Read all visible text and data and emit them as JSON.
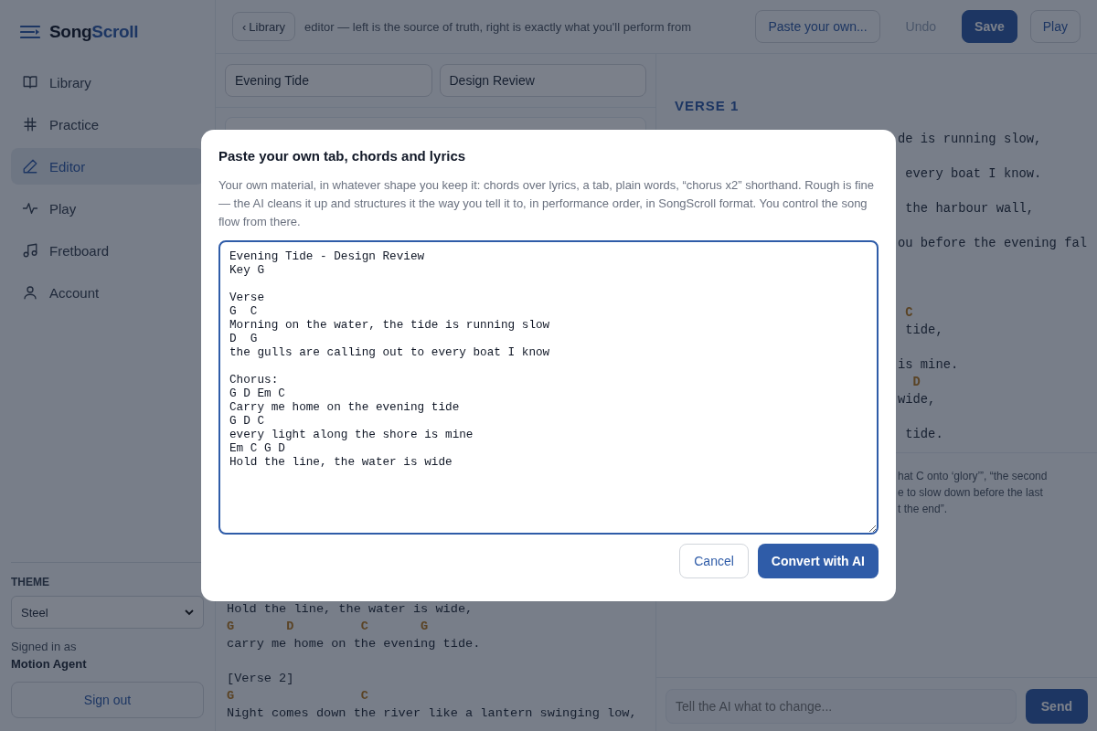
{
  "app": {
    "logo_prefix": "Song",
    "logo_suffix": "Scroll"
  },
  "sidebar": {
    "items": [
      {
        "label": "Library",
        "selected": false
      },
      {
        "label": "Practice",
        "selected": false
      },
      {
        "label": "Editor",
        "selected": true
      },
      {
        "label": "Play",
        "selected": false
      },
      {
        "label": "Fretboard",
        "selected": false
      },
      {
        "label": "Account",
        "selected": false
      }
    ],
    "theme_label": "THEME",
    "theme_value": "Steel",
    "signed_in_label": "Signed in as",
    "user_name": "Motion Agent",
    "sign_out": "Sign out"
  },
  "toolbar": {
    "back_icon": "‹",
    "back_button": "Library",
    "subtitle": "editor — left is the source of truth, right is exactly what you'll perform from",
    "buttons": [
      {
        "label": "Paste your own...",
        "kind": "outline",
        "disabled": false
      },
      {
        "label": "Undo",
        "kind": "plain",
        "disabled": true
      },
      {
        "label": "Save",
        "kind": "primary",
        "disabled": false
      },
      {
        "label": "Play",
        "kind": "outline",
        "disabled": false
      }
    ]
  },
  "editor": {
    "title": "Evening Tide",
    "artist": "Design Review",
    "lines": [
      {
        "kind": "lyric",
        "text": "Hold the line, the water is wide,"
      },
      {
        "kind": "chord",
        "text": "G       D         C       G"
      },
      {
        "kind": "lyric",
        "text": "carry me home on the evening tide."
      },
      {
        "kind": "blank"
      },
      {
        "kind": "lyric",
        "text": "[Verse 2]"
      },
      {
        "kind": "chord",
        "text": "G                 C"
      },
      {
        "kind": "lyric",
        "text": "Night comes down the river like a lantern swinging low,"
      }
    ]
  },
  "preview": {
    "section": "VERSE 1",
    "lines": [
      {
        "kind": "blank"
      },
      {
        "kind": "lyric",
        "text": "de is running slow,"
      },
      {
        "kind": "blank"
      },
      {
        "kind": "lyric",
        "text": " every boat I know."
      },
      {
        "kind": "blank"
      },
      {
        "kind": "lyric",
        "text": " the harbour wall,"
      },
      {
        "kind": "blank"
      },
      {
        "kind": "lyric",
        "text": "ou before the evening fal"
      },
      {
        "kind": "blank"
      },
      {
        "kind": "blank"
      },
      {
        "kind": "blank"
      },
      {
        "kind": "chord",
        "text": " C"
      },
      {
        "kind": "lyric",
        "text": " tide,"
      },
      {
        "kind": "blank"
      },
      {
        "kind": "lyric",
        "text": "is mine."
      },
      {
        "kind": "chord",
        "text": "  D"
      },
      {
        "kind": "lyric",
        "text": "wide,"
      },
      {
        "kind": "blank"
      },
      {
        "kind": "lyric",
        "text": " tide."
      }
    ],
    "note_lines": [
      "hat C onto ‘glory’”, “the second",
      "e to slow down before the last",
      "t the end”."
    ],
    "chat_placeholder": "Tell the AI what to change...",
    "send": "Send"
  },
  "dialog": {
    "title": "Paste your own tab, chords and lyrics",
    "description": "Your own material, in whatever shape you keep it: chords over lyrics, a tab, plain words, “chorus x2” shorthand. Rough is fine — the AI cleans it up and structures it the way you tell it to, in performance order, in SongScroll format. You control the song flow from there.",
    "value": "Evening Tide - Design Review\nKey G\n\nVerse\nG  C\nMorning on the water, the tide is running slow\nD  G\nthe gulls are calling out to every boat I know\n\nChorus:\nG D Em C\nCarry me home on the evening tide\nG D C\nevery light along the shore is mine\nEm C G D\nHold the line, the water is wide",
    "cancel": "Cancel",
    "confirm": "Convert with AI"
  }
}
